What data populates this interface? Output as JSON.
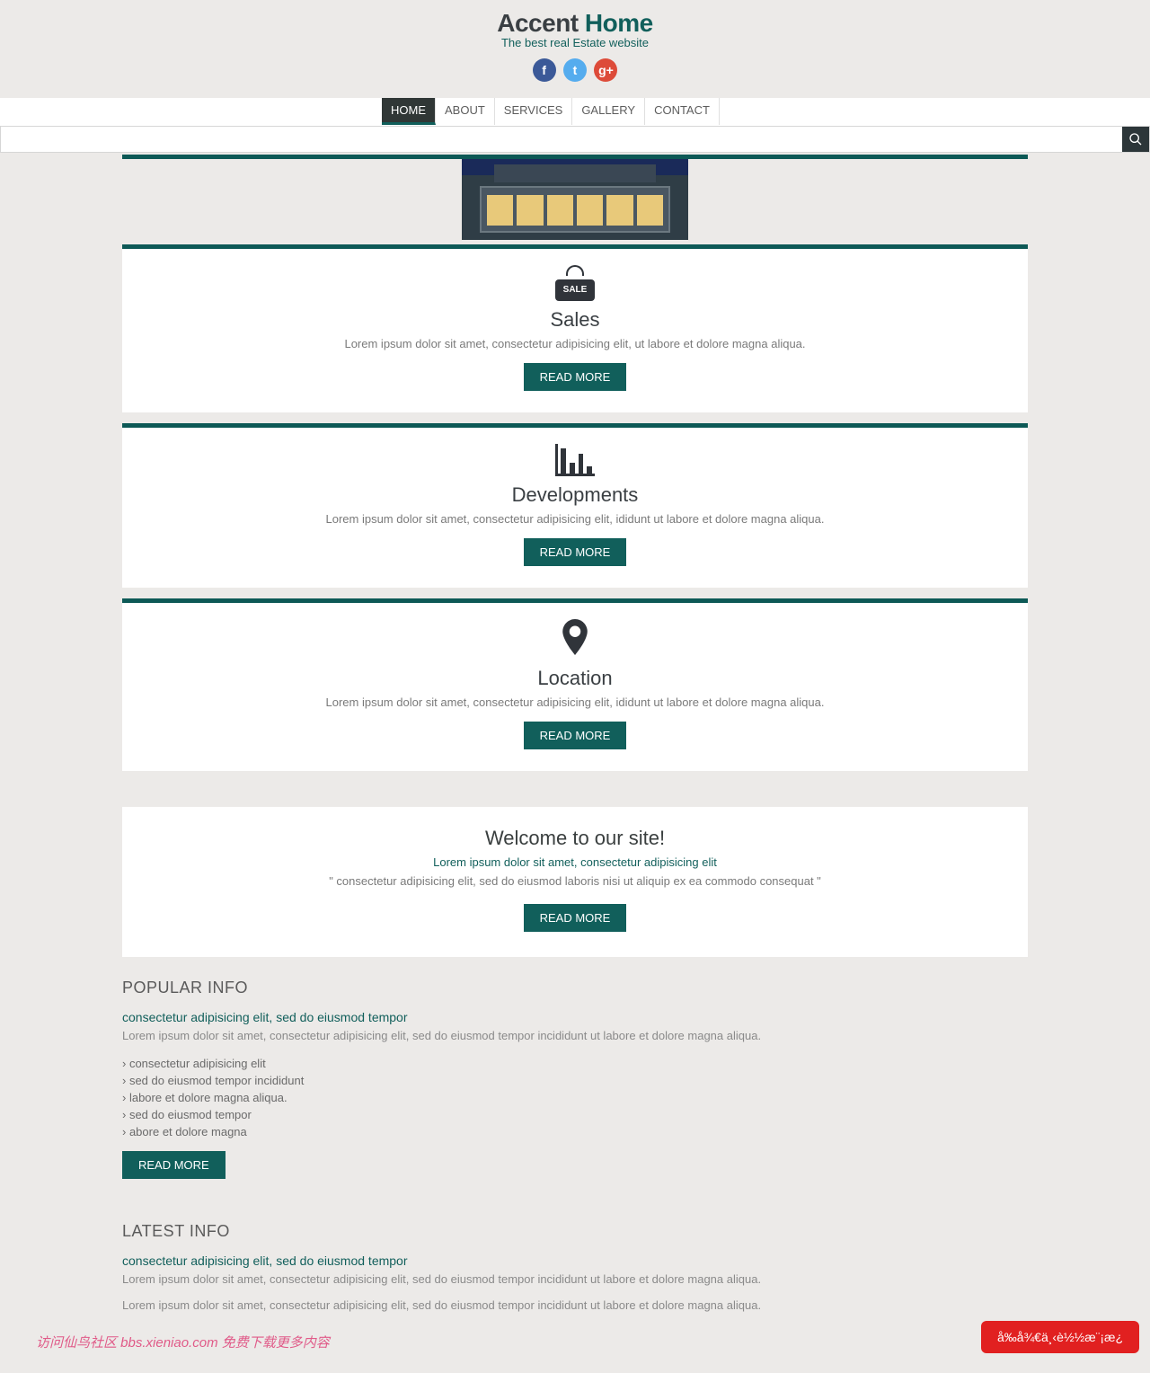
{
  "brand": {
    "part1": "Accent ",
    "part2": "Home",
    "tagline": "The best real Estate website"
  },
  "social": {
    "fb": "f",
    "tw": "t",
    "gp": "g+"
  },
  "nav": {
    "items": [
      {
        "label": "HOME",
        "active": true
      },
      {
        "label": "ABOUT"
      },
      {
        "label": "SERVICES"
      },
      {
        "label": "GALLERY"
      },
      {
        "label": "CONTACT"
      }
    ]
  },
  "search": {
    "value": ""
  },
  "cards": [
    {
      "icon": "sale",
      "title": "Sales",
      "text": "Lorem ipsum dolor sit amet, consectetur adipisicing elit, ut labore et dolore magna aliqua.",
      "cta": "READ MORE"
    },
    {
      "icon": "bars",
      "title": "Developments",
      "text": "Lorem ipsum dolor sit amet, consectetur adipisicing elit, ididunt ut labore et dolore magna aliqua.",
      "cta": "READ MORE"
    },
    {
      "icon": "pin",
      "title": "Location",
      "text": "Lorem ipsum dolor sit amet, consectetur adipisicing elit, ididunt ut labore et dolore magna aliqua.",
      "cta": "READ MORE"
    }
  ],
  "welcome": {
    "title": "Welcome to our site!",
    "subtitle": "Lorem ipsum dolor sit amet, consectetur adipisicing elit",
    "quote": "\" consectetur adipisicing elit, sed do eiusmod laboris nisi ut aliquip ex ea commodo consequat \"",
    "cta": "READ MORE"
  },
  "popular": {
    "heading": "POPULAR INFO",
    "link": "consectetur adipisicing elit, sed do eiusmod tempor",
    "desc": "Lorem ipsum dolor sit amet, consectetur adipisicing elit, sed do eiusmod tempor incididunt ut labore et dolore magna aliqua.",
    "items": [
      "consectetur adipisicing elit",
      "sed do eiusmod tempor incididunt",
      "labore et dolore magna aliqua.",
      "sed do eiusmod tempor",
      "abore et dolore magna"
    ],
    "cta": "READ MORE"
  },
  "latest": {
    "heading": "LATEST INFO",
    "link": "consectetur adipisicing elit, sed do eiusmod tempor",
    "p1": "Lorem ipsum dolor sit amet, consectetur adipisicing elit, sed do eiusmod tempor incididunt ut labore et dolore magna aliqua.",
    "p2": "Lorem ipsum dolor sit amet, consectetur adipisicing elit, sed do eiusmod tempor incididunt ut labore et dolore magna aliqua."
  },
  "badge": "å‰å¾€ä¸‹è½½æ¨¡æ¿",
  "watermark": "访问仙鸟社区 bbs.xieniao.com 免费下载更多内容"
}
